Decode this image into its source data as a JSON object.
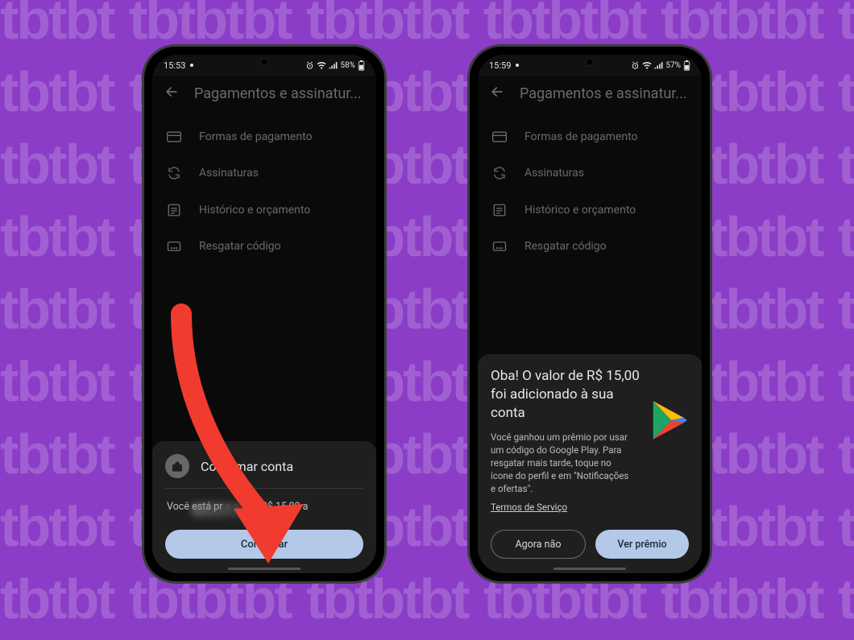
{
  "phone_left": {
    "status": {
      "time": "15:53",
      "battery_text": "58%"
    },
    "header": {
      "title": "Pagamentos e assinatur..."
    },
    "menu": {
      "items": [
        {
          "label": "Formas de pagamento"
        },
        {
          "label": "Assinaturas"
        },
        {
          "label": "Histórico e orçamento"
        },
        {
          "label": "Resgatar código"
        }
      ]
    },
    "sheet": {
      "title": "Confirmar conta",
      "body_prefix": "Você está pr",
      "body_mid": "a a",
      "body_amount": "R$ 15,00 a",
      "confirm_label": "Confirmar"
    }
  },
  "phone_right": {
    "status": {
      "time": "15:59",
      "battery_text": "57%"
    },
    "header": {
      "title": "Pagamentos e assinatur..."
    },
    "menu": {
      "items": [
        {
          "label": "Formas de pagamento"
        },
        {
          "label": "Assinaturas"
        },
        {
          "label": "Histórico e orçamento"
        },
        {
          "label": "Resgatar código"
        }
      ]
    },
    "sheet": {
      "title": "Oba! O valor de R$ 15,00 foi adicionado à sua conta",
      "body": "Você ganhou um prêmio por usar um código do Google Play. Para resgatar mais tarde, toque no ícone do perfil e em \"Notificações e ofertas\".",
      "terms_label": "Termos de Serviço",
      "later_label": "Agora não",
      "view_label": "Ver prêmio"
    }
  }
}
